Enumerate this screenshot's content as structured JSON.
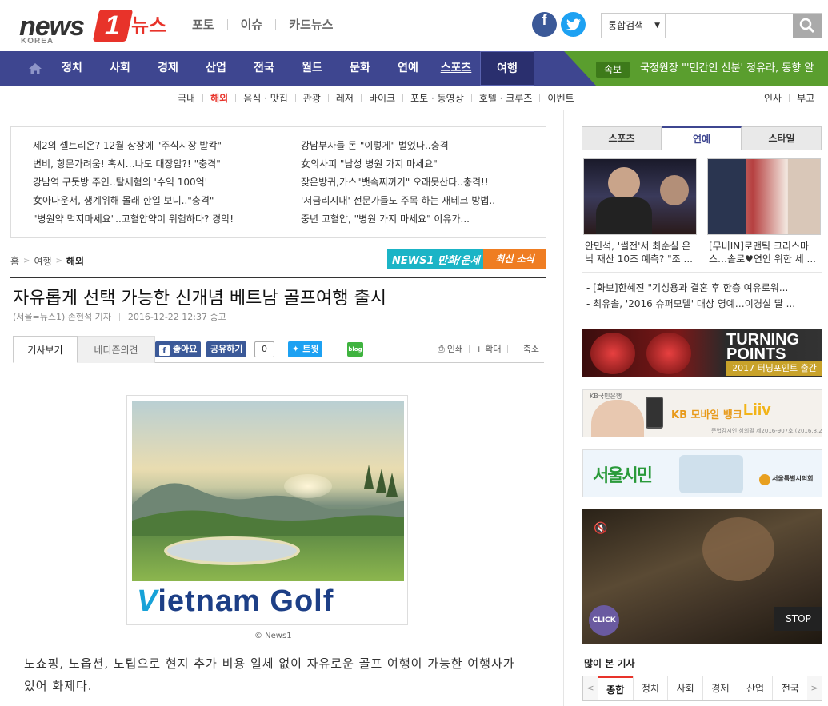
{
  "logo": {
    "brand": "news",
    "one": "1",
    "korean": "뉴스",
    "korea": "KOREA"
  },
  "top_nav": [
    "포토",
    "이슈",
    "카드뉴스"
  ],
  "social": {
    "facebook": "f",
    "twitter": "t"
  },
  "search": {
    "scope": "통합검색",
    "placeholder": ""
  },
  "main_nav": [
    "정치",
    "사회",
    "경제",
    "산업",
    "전국",
    "월드",
    "문화",
    "연예",
    "스포츠",
    "여행"
  ],
  "breaking": {
    "tag": "속보",
    "text": "국정원장 \"'민간인 신분' 정유라, 동향 알"
  },
  "sub_nav": [
    "국내",
    "해외",
    "음식 · 맛집",
    "관광",
    "레저",
    "바이크",
    "포토 · 동영상",
    "호텔 · 크루즈",
    "이벤트"
  ],
  "sub_right": [
    "인사",
    "부고"
  ],
  "headlines_left": [
    "제2의 셀트리온? 12월 상장에 \"주식시장 발칵\"",
    "변비, 항문가려움! 혹시…나도 대장암?! \"충격\"",
    "강남역 구둣방 주인..탈세혐의 '수익 100억'",
    "女아나운서, 생계위해 몰래 한일 보니..\"충격\"",
    "\"병원약 먹지마세요\"..고혈압약이 위험하다? 경악!"
  ],
  "headlines_right": [
    "강남부자들 돈 \"이렇게\" 벌었다..충격",
    "女의사피 \"남성 병원 가지 마세요\"",
    "잦은방귀,가스\"뱃속찌꺼기\" 오래못산다..충격!!",
    "'저금리시대' 전문가들도 주목 하는 재테크 방법..",
    "중년 고혈압, \"병원 가지 마세요\" 이유가..."
  ],
  "breadcrumb": [
    "홈",
    "여행",
    "해외"
  ],
  "promo_banner": {
    "left": "NEWS1 만화/운세",
    "right": "최신 소식"
  },
  "article": {
    "title": "자유롭게 선택 가능한 신개념 베트남 골프여행 출시",
    "byline": "(서울=뉴스1) 손현석 기자",
    "date": "2016-12-22 12:37 송고",
    "tab_article": "기사보기",
    "tab_comments": "네티즌의견",
    "fb_like": "좋아요",
    "share": "공유하기",
    "share_count": "0",
    "tweet": "트윗",
    "blog": "blog",
    "print": "인쇄",
    "zoom_in": "확대",
    "zoom_out": "축소",
    "photo_logo_v": "V",
    "photo_logo_rest": "ietnam Golf",
    "credit": "© News1",
    "body": "노쇼핑, 노옵션, 노팁으로 현지 추가 비용 일체 없이 자유로운 골프 여행이 가능한 여행사가 있어 화제다."
  },
  "sidebar": {
    "tabs": [
      "스포츠",
      "연예",
      "스타일"
    ],
    "active_tab": 1,
    "thumb_captions": [
      "안민석, '썰전'서 최순실 은닉 재산 10조 예측? \"조 ...",
      "[무비IN]로맨틱 크리스마스…솔로♥연인 위한 세 ..."
    ],
    "list": [
      "[화보]한혜진 \"기성용과 결혼 후 한층 여유로워...",
      "최유솔, '2016 슈퍼모델' 대상 영예…이경실 딸 ..."
    ],
    "ad1_title": "TURNING POINTS",
    "ad1_sub": "2017 터닝포인트 출간",
    "ad2_bank": "KB국민은행",
    "ad2_text": "KB 모바일 뱅크",
    "ad2_brand": "Liiv",
    "ad2_fine": "준법감시인 심의필 제2016-907호 (2016.8.25)",
    "ad3_text": "서울시민",
    "ad3_org": "서울특별시의회",
    "video_click": "CLICK",
    "video_stop": "STOP",
    "popular_title": "많이 본 기사",
    "popular_tabs": [
      "종합",
      "정치",
      "사회",
      "경제",
      "산업",
      "전국"
    ]
  },
  "colors": {
    "brand_red": "#e8332a",
    "nav_blue": "#3e4690",
    "breaking_green": "#5a9e2e"
  }
}
